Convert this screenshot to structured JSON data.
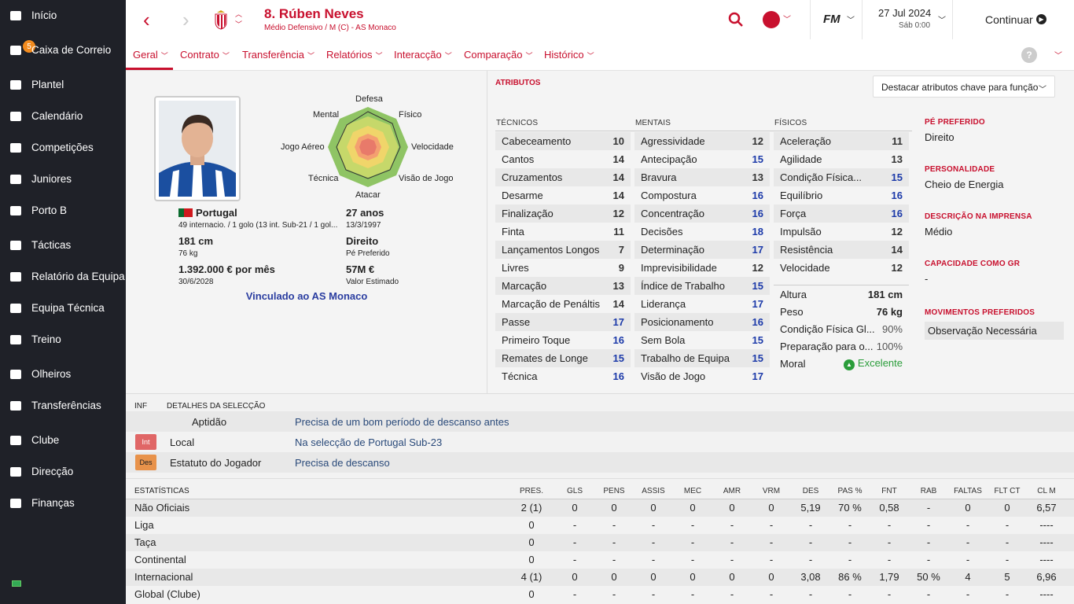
{
  "sidebar": {
    "items": [
      {
        "label": "Início",
        "icon": "home-icon"
      },
      {
        "label": "Caixa de Correio",
        "icon": "inbox-icon",
        "badge": "5"
      },
      {
        "label": "Plantel",
        "icon": "squad-icon"
      },
      {
        "label": "Calendário",
        "icon": "calendar-icon"
      },
      {
        "label": "Competições",
        "icon": "trophy-icon"
      },
      {
        "label": "Juniores",
        "icon": "juniors-icon"
      },
      {
        "label": "Porto B",
        "icon": "b-team-icon"
      },
      {
        "label": "Tácticas",
        "icon": "tactics-icon"
      },
      {
        "label": "Relatório da Equipa",
        "icon": "report-icon"
      },
      {
        "label": "Equipa Técnica",
        "icon": "staff-icon"
      },
      {
        "label": "Treino",
        "icon": "training-icon"
      },
      {
        "label": "Olheiros",
        "icon": "scouting-icon"
      },
      {
        "label": "Transferências",
        "icon": "transfers-icon"
      },
      {
        "label": "Clube",
        "icon": "club-icon"
      },
      {
        "label": "Direcção",
        "icon": "board-icon"
      },
      {
        "label": "Finanças",
        "icon": "finance-icon"
      }
    ]
  },
  "header": {
    "player_title": "8. Rúben Neves",
    "subtitle": "Médio Defensivo / M (C) - AS Monaco",
    "date": "27 Jul 2024",
    "day_time": "Sáb 0:00",
    "continue_label": "Continuar",
    "fm_label": "FM"
  },
  "tabs": [
    "Geral",
    "Contrato",
    "Transferência",
    "Relatórios",
    "Interacção",
    "Comparação",
    "Histórico"
  ],
  "radar": {
    "labels": {
      "top": "Defesa",
      "top_right": "Físico",
      "right": "Velocidade",
      "bottom_right": "Visão de Jogo",
      "bottom": "Atacar",
      "bottom_left": "Técnica",
      "left": "Jogo Aéreo",
      "top_left": "Mental"
    }
  },
  "profile": {
    "nationality": "Portugal",
    "caps": "49 internacio. / 1 golo (13 int. Sub-21 / 1 gol...",
    "age": "27 anos",
    "dob": "13/3/1997",
    "height": "181 cm",
    "weight": "76 kg",
    "foot": "Direito",
    "foot_label": "Pé Preferido",
    "wage": "1.392.000 € por mês",
    "contract_end": "30/6/2028",
    "value": "57M €",
    "value_label": "Valor Estimado",
    "link": "Vinculado ao AS Monaco"
  },
  "attributes": {
    "title": "ATRIBUTOS",
    "highlight_dropdown": "Destacar atributos chave para função",
    "tecnicos_label": "TÉCNICOS",
    "mentais_label": "MENTAIS",
    "fisicos_label": "FÍSICOS",
    "tecnicos": [
      [
        "Cabeceamento",
        "10"
      ],
      [
        "Cantos",
        "14"
      ],
      [
        "Cruzamentos",
        "14"
      ],
      [
        "Desarme",
        "14"
      ],
      [
        "Finalização",
        "12"
      ],
      [
        "Finta",
        "11"
      ],
      [
        "Lançamentos Longos",
        "7"
      ],
      [
        "Livres",
        "9"
      ],
      [
        "Marcação",
        "13"
      ],
      [
        "Marcação de Penáltis",
        "14"
      ],
      [
        "Passe",
        "17"
      ],
      [
        "Primeiro Toque",
        "16"
      ],
      [
        "Remates de Longe",
        "15"
      ],
      [
        "Técnica",
        "16"
      ]
    ],
    "mentais": [
      [
        "Agressividade",
        "12"
      ],
      [
        "Antecipação",
        "15"
      ],
      [
        "Bravura",
        "13"
      ],
      [
        "Compostura",
        "16"
      ],
      [
        "Concentração",
        "16"
      ],
      [
        "Decisões",
        "18"
      ],
      [
        "Determinação",
        "17"
      ],
      [
        "Imprevisibilidade",
        "12"
      ],
      [
        "Índice de Trabalho",
        "15"
      ],
      [
        "Liderança",
        "17"
      ],
      [
        "Posicionamento",
        "16"
      ],
      [
        "Sem Bola",
        "15"
      ],
      [
        "Trabalho de Equipa",
        "15"
      ],
      [
        "Visão de Jogo",
        "17"
      ]
    ],
    "fisicos": [
      [
        "Aceleração",
        "11"
      ],
      [
        "Agilidade",
        "13"
      ],
      [
        "Condição Física...",
        "15"
      ],
      [
        "Equilíbrio",
        "16"
      ],
      [
        "Força",
        "16"
      ],
      [
        "Impulsão",
        "12"
      ],
      [
        "Resistência",
        "14"
      ],
      [
        "Velocidade",
        "12"
      ]
    ],
    "extra": [
      [
        "Altura",
        "181 cm"
      ],
      [
        "Peso",
        "76 kg"
      ],
      [
        "Condição Física Gl...",
        "90%"
      ],
      [
        "Preparação para o...",
        "100%"
      ],
      [
        "Moral",
        "Excelente"
      ]
    ]
  },
  "side": {
    "foot_h": "PÉ PREFERIDO",
    "foot_v": "Direito",
    "pers_h": "PERSONALIDADE",
    "pers_v": "Cheio de Energia",
    "press_h": "DESCRIÇÃO NA IMPRENSA",
    "press_v": "Médio",
    "cap_h": "CAPACIDADE COMO GR",
    "cap_v": "-",
    "moves_h": "MOVIMENTOS PREFERIDOS",
    "moves_v": "Observação Necessária"
  },
  "selection": {
    "inf_label": "INF",
    "details_label": "DETALHES DA SELECÇÃO",
    "rows": [
      {
        "tag": "",
        "key": "Aptidão",
        "value": "Precisa de um bom período de descanso antes"
      },
      {
        "tag": "Int",
        "key": "Local",
        "value": "Na selecção de Portugal Sub-23"
      },
      {
        "tag": "Des",
        "key": "Estatuto do Jogador",
        "value": "Precisa de descanso"
      }
    ]
  },
  "stats": {
    "label": "ESTATÍSTICAS",
    "headers": [
      "PRES.",
      "GLS",
      "PENS",
      "ASSIS",
      "MEC",
      "AMR",
      "VRM",
      "DES",
      "PAS %",
      "FNT",
      "RAB",
      "FALTAS",
      "FLT CT",
      "CL M"
    ],
    "rows": [
      {
        "name": "Não Oficiais",
        "vals": [
          "2 (1)",
          "0",
          "0",
          "0",
          "0",
          "0",
          "0",
          "5,19",
          "70 %",
          "0,58",
          "-",
          "0",
          "0",
          "6,57"
        ]
      },
      {
        "name": "Liga",
        "vals": [
          "0",
          "-",
          "-",
          "-",
          "-",
          "-",
          "-",
          "-",
          "-",
          "-",
          "-",
          "-",
          "-",
          "----"
        ]
      },
      {
        "name": "Taça",
        "vals": [
          "0",
          "-",
          "-",
          "-",
          "-",
          "-",
          "-",
          "-",
          "-",
          "-",
          "-",
          "-",
          "-",
          "----"
        ]
      },
      {
        "name": "Continental",
        "vals": [
          "0",
          "-",
          "-",
          "-",
          "-",
          "-",
          "-",
          "-",
          "-",
          "-",
          "-",
          "-",
          "-",
          "----"
        ]
      },
      {
        "name": "Internacional",
        "vals": [
          "4 (1)",
          "0",
          "0",
          "0",
          "0",
          "0",
          "0",
          "3,08",
          "86 %",
          "1,79",
          "50 %",
          "4",
          "5",
          "6,96"
        ]
      },
      {
        "name": "Global (Clube)",
        "vals": [
          "0",
          "-",
          "-",
          "-",
          "-",
          "-",
          "-",
          "-",
          "-",
          "-",
          "-",
          "-",
          "-",
          "----"
        ]
      }
    ]
  },
  "colors": {
    "accent": "#c8102e",
    "sidebar": "#1f2128",
    "highlight_value": "#1c3aa9",
    "morale": "#2a9d3a"
  }
}
